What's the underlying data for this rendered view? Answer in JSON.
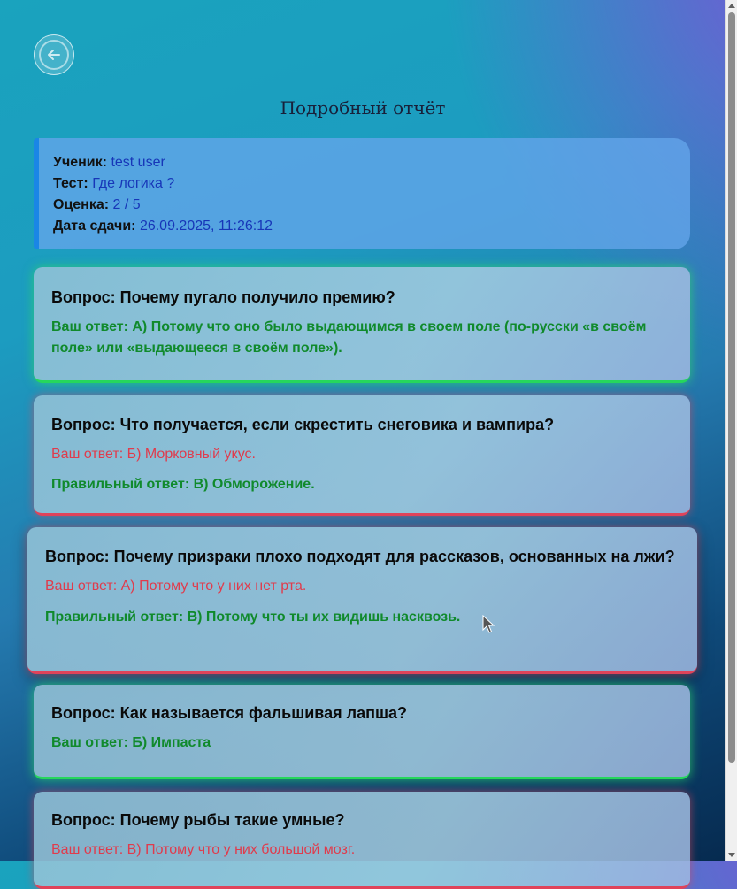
{
  "page": {
    "title": "Подробный отчёт",
    "back_icon": "arrow-left-circle-icon"
  },
  "info": {
    "student_label": "Ученик:",
    "student_value": "test user",
    "test_label": "Тест:",
    "test_value": "Где логика ?",
    "score_label": "Оценка:",
    "score_value": "2 / 5",
    "date_label": "Дата сдачи:",
    "date_value": "26.09.2025, 11:26:12"
  },
  "questions": [
    {
      "question": "Вопрос: Почему пугало получило премию?",
      "your_answer": "Ваш ответ: А) Потому что оно было выдающимся в своем поле (по-русски «в своём поле» или «выдающееся в своём поле»).",
      "correct_answer": ""
    },
    {
      "question": "Вопрос: Что получается, если скрестить снеговика и вампира?",
      "your_answer": "Ваш ответ: Б) Морковный укус.",
      "correct_answer": "Правильный ответ: В) Обморожение."
    },
    {
      "question": "Вопрос: Почему призраки плохо подходят для рассказов, основанных на лжи?",
      "your_answer": "Ваш ответ: А) Потому что у них нет рта.",
      "correct_answer": "Правильный ответ: В) Потому что ты их видишь насквозь."
    },
    {
      "question": "Вопрос: Как называется фальшивая лапша?",
      "your_answer": "Ваш ответ: Б) Импаста",
      "correct_answer": ""
    },
    {
      "question": "Вопрос: Почему рыбы такие умные?",
      "your_answer": "Ваш ответ: В) Потому что у них большой мозг.",
      "correct_answer": ""
    }
  ],
  "colors": {
    "correct": "#108a2c",
    "wrong": "#e03b4c",
    "accent": "#1a86e6"
  }
}
